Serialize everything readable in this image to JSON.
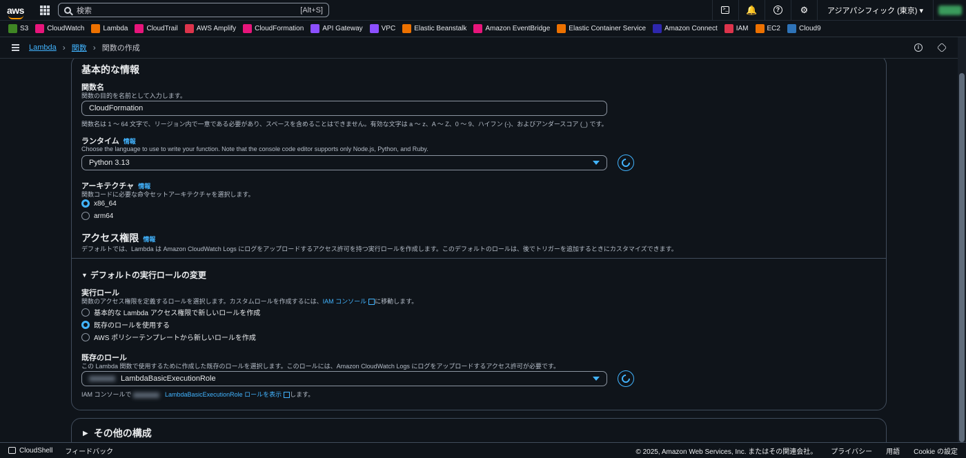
{
  "topnav": {
    "logo": "aws",
    "search_placeholder": "検索",
    "search_hint": "[Alt+S]",
    "region": "アジアパシフィック (東京) ▾",
    "icons": [
      "cloudshell-icon",
      "bell-icon",
      "help-icon",
      "gear-icon"
    ]
  },
  "favorites": [
    {
      "label": "S3",
      "color": "#3f8624"
    },
    {
      "label": "CloudWatch",
      "color": "#e7157b"
    },
    {
      "label": "Lambda",
      "color": "#ed7100"
    },
    {
      "label": "CloudTrail",
      "color": "#e7157b"
    },
    {
      "label": "AWS Amplify",
      "color": "#dd344c"
    },
    {
      "label": "CloudFormation",
      "color": "#e7157b"
    },
    {
      "label": "API Gateway",
      "color": "#8c4fff"
    },
    {
      "label": "VPC",
      "color": "#8c4fff"
    },
    {
      "label": "Elastic Beanstalk",
      "color": "#ed7100"
    },
    {
      "label": "Amazon EventBridge",
      "color": "#e7157b"
    },
    {
      "label": "Elastic Container Service",
      "color": "#ed7100"
    },
    {
      "label": "Amazon Connect",
      "color": "#2e27ad"
    },
    {
      "label": "IAM",
      "color": "#dd344c"
    },
    {
      "label": "EC2",
      "color": "#ed7100"
    },
    {
      "label": "Cloud9",
      "color": "#2e73b8"
    }
  ],
  "breadcrumb": {
    "lambda": "Lambda",
    "functions": "関数",
    "current": "関数の作成"
  },
  "basic": {
    "title": "基本的な情報",
    "fn_name_label": "関数名",
    "fn_name_desc": "関数の目的を名前として入力します。",
    "fn_name_value": "CloudFormation",
    "fn_name_constraint": "関数名は 1 ～ 64 文字で、リージョン内で一意である必要があり、スペースを含めることはできません。有効な文字は a ～ z、A ～ Z、0 ～ 9、ハイフン (-)、およびアンダースコア (_) です。",
    "runtime_label": "ランタイム",
    "info": "情報",
    "runtime_desc": "Choose the language to use to write your function. Note that the console code editor supports only Node.js, Python, and Ruby.",
    "runtime_value": "Python 3.13",
    "arch_label": "アーキテクチャ",
    "arch_desc": "関数コードに必要な命令セットアーキテクチャを選択します。",
    "arch_x86": "x86_64",
    "arch_arm": "arm64",
    "perm_title": "アクセス権限",
    "perm_desc": "デフォルトでは、Lambda は Amazon CloudWatch Logs にログをアップロードするアクセス許可を持つ実行ロールを作成します。このデフォルトのロールは、後でトリガーを追加するときにカスタマイズできます。"
  },
  "role": {
    "toggle_title": "デフォルトの実行ロールの変更",
    "exec_label": "実行ロール",
    "exec_desc_pre": "関数のアクセス権限を定義するロールを選択します。カスタムロールを作成するには、",
    "exec_desc_link": "IAM コンソール",
    "exec_desc_post": "に移動します。",
    "opt1": "基本的な Lambda アクセス権限で新しいロールを作成",
    "opt2": "既存のロールを使用する",
    "opt3": "AWS ポリシーテンプレートから新しいロールを作成",
    "existing_label": "既存のロール",
    "existing_desc": "この Lambda 関数で使用するために作成した既存のロールを選択します。このロールには、Amazon CloudWatch Logs にログをアップロードするアクセス許可が必要です。",
    "existing_value": "LambdaBasicExecutionRole",
    "view_pre": "IAM コンソールで",
    "view_link": "LambdaBasicExecutionRole ロールを表示",
    "view_post": "します。"
  },
  "other": {
    "title": "その他の構成"
  },
  "footer": {
    "cloudshell": "CloudShell",
    "feedback": "フィードバック",
    "copyright": "© 2025, Amazon Web Services, Inc. またはその関連会社。",
    "privacy": "プライバシー",
    "terms": "用語",
    "cookie": "Cookie の設定"
  }
}
